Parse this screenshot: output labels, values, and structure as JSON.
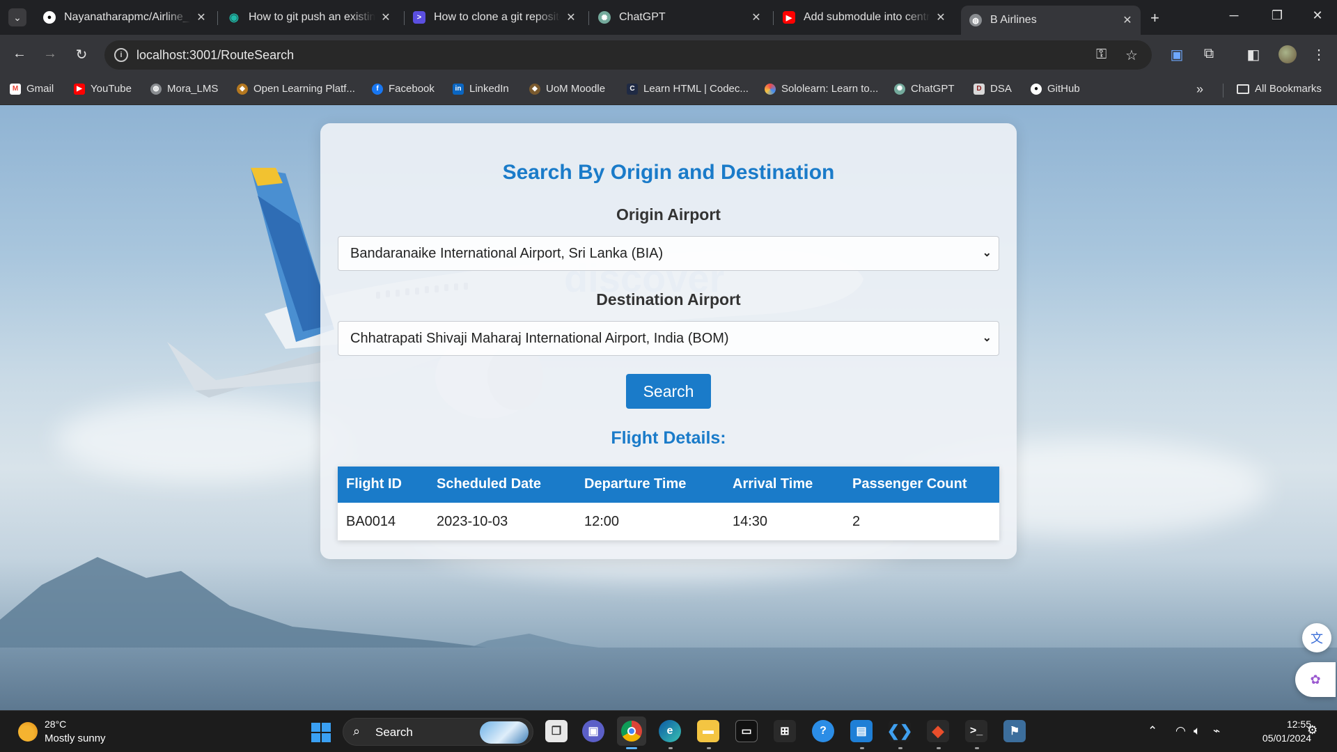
{
  "browser": {
    "tabs": [
      {
        "title": "Nayanatharapmc/Airline_Ri",
        "icon": "github-icon"
      },
      {
        "title": "How to git push an existing",
        "icon": "eye-icon"
      },
      {
        "title": "How to clone a git reposito",
        "icon": "terminal-icon"
      },
      {
        "title": "ChatGPT",
        "icon": "chatgpt-icon"
      },
      {
        "title": "Add submodule into centra",
        "icon": "youtube-icon"
      },
      {
        "title": "B Airlines",
        "icon": "globe-icon",
        "active": true
      }
    ],
    "url": "localhost:3001/RouteSearch",
    "bookmarks": [
      {
        "label": "Gmail",
        "icon": "gmail-icon"
      },
      {
        "label": "YouTube",
        "icon": "youtube-icon"
      },
      {
        "label": "Mora_LMS",
        "icon": "globe-icon"
      },
      {
        "label": "Open Learning Platf...",
        "icon": "ol-icon"
      },
      {
        "label": "Facebook",
        "icon": "facebook-icon"
      },
      {
        "label": "LinkedIn",
        "icon": "linkedin-icon"
      },
      {
        "label": "UoM Moodle",
        "icon": "moodle-icon"
      },
      {
        "label": "Learn HTML | Codec...",
        "icon": "codecademy-icon"
      },
      {
        "label": "Sololearn: Learn to...",
        "icon": "sololearn-icon"
      },
      {
        "label": "ChatGPT",
        "icon": "chatgpt-icon"
      },
      {
        "label": "DSA",
        "icon": "dsa-icon"
      },
      {
        "label": "GitHub",
        "icon": "github-icon"
      }
    ],
    "all_bookmarks": "All Bookmarks"
  },
  "page": {
    "heading": "Search By Origin and Destination",
    "origin_label": "Origin Airport",
    "origin_value": "Bandaranaike International Airport, Sri Lanka (BIA)",
    "destination_label": "Destination Airport",
    "destination_value": "Chhatrapati Shivaji Maharaj International Airport, India (BOM)",
    "search_button": "Search",
    "results_heading": "Flight Details:",
    "table": {
      "headers": [
        "Flight ID",
        "Scheduled Date",
        "Departure Time",
        "Arrival Time",
        "Passenger Count"
      ],
      "rows": [
        [
          "BA0014",
          "2023-10-03",
          "12:00",
          "14:30",
          "2"
        ]
      ]
    },
    "plane_livery_text": "discover",
    "accent_color": "#1a7bc9"
  },
  "taskbar": {
    "weather_temp": "28°C",
    "weather_desc": "Mostly sunny",
    "search_placeholder": "Search",
    "time": "12:55",
    "date": "05/01/2024"
  }
}
